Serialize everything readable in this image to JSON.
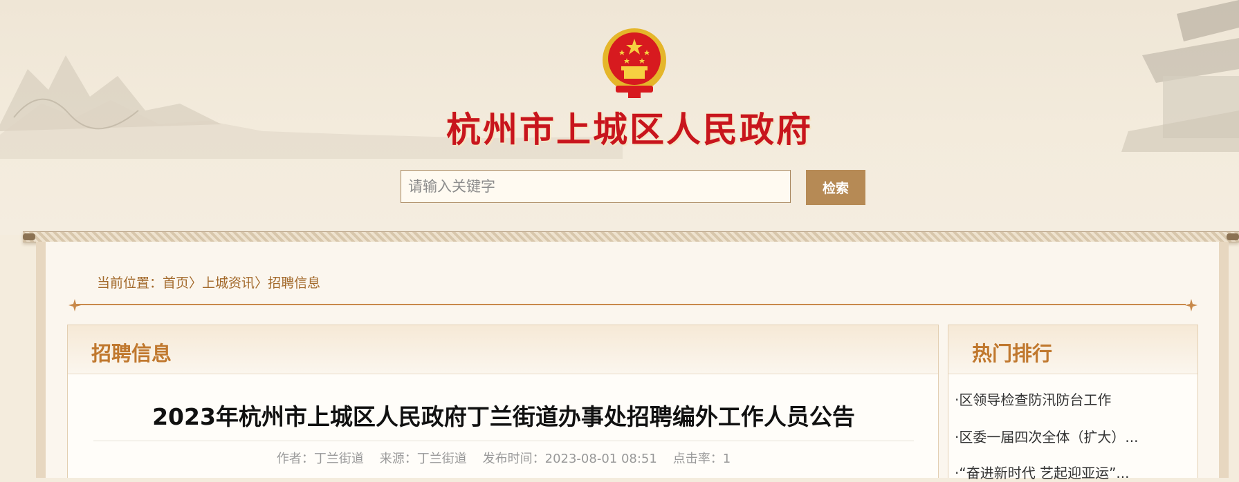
{
  "header": {
    "site_title": "杭州市上城区人民政府",
    "emblem_icon": "national-emblem-icon",
    "title_color": "#c8151d"
  },
  "search": {
    "placeholder": "请输入关键字",
    "value": "",
    "button_label": "检索",
    "button_color": "#b68a55"
  },
  "breadcrumb": {
    "prefix": "当前位置：",
    "items": [
      "首页",
      "上城资讯",
      "招聘信息"
    ],
    "separator": "〉"
  },
  "main": {
    "section_title": "招聘信息",
    "article": {
      "title": "2023年杭州市上城区人民政府丁兰街道办事处招聘编外工作人员公告",
      "meta": "作者：丁兰街道    来源：丁兰街道    发布时间：2023-08-01 08:51    点击率：1"
    }
  },
  "sidebar": {
    "title": "热门排行",
    "items": [
      "·区领导检查防汛防台工作",
      "·区委一届四次全体（扩大）...",
      "·“奋进新时代 艺起迎亚运”..."
    ]
  },
  "colors": {
    "accent": "#c0782e",
    "paper": "#fbf6ee",
    "breadcrumb": "#a36a2c"
  }
}
